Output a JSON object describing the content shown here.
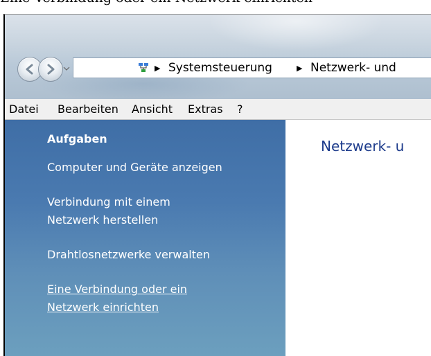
{
  "caption": "Eine Verbindung oder ein Netzwerk einrichten",
  "address_bar": {
    "breadcrumb": [
      "Systemsteuerung",
      "Netzwerk- und"
    ]
  },
  "menu": [
    "Datei",
    "Bearbeiten",
    "Ansicht",
    "Extras",
    "?"
  ],
  "sidebar": {
    "heading": "Aufgaben",
    "items": [
      {
        "lines": [
          "Computer und Geräte anzeigen"
        ]
      },
      {
        "lines": [
          "Verbindung mit einem",
          "Netzwerk herstellen"
        ]
      },
      {
        "lines": [
          "Drahtlosnetzwerke verwalten"
        ]
      },
      {
        "lines": [
          "Eine Verbindung oder ein ",
          "Netzwerk einrichten"
        ]
      }
    ]
  },
  "main": {
    "title": "Netzwerk- u"
  },
  "colors": {
    "sidebar_top": "#3f6ea6",
    "sidebar_bottom": "#6c9fbe",
    "title_blue": "#1e3c8c"
  },
  "icons": [
    "back-arrow-icon",
    "forward-arrow-icon",
    "chevron-down-icon",
    "network-icon",
    "breadcrumb-arrow-icon"
  ]
}
